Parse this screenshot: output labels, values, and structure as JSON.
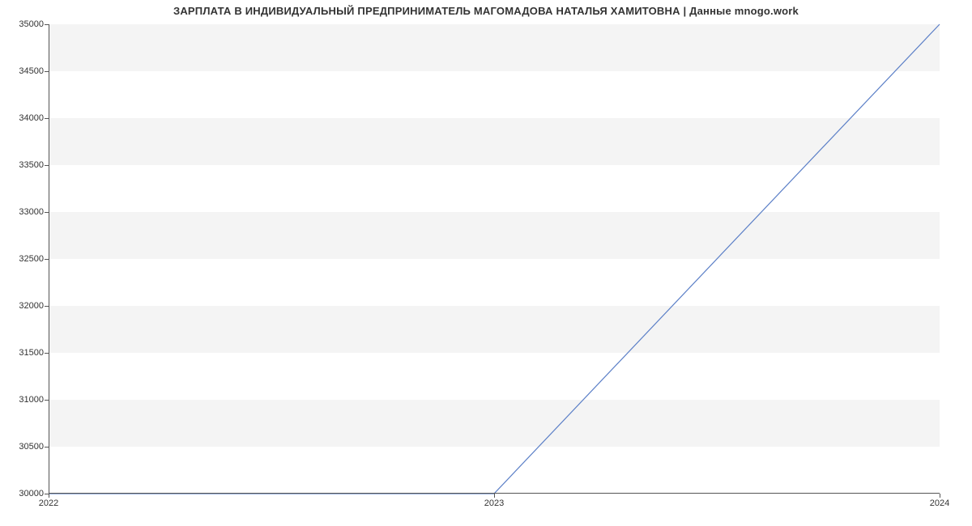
{
  "chart_data": {
    "type": "line",
    "title": "ЗАРПЛАТА В ИНДИВИДУАЛЬНЫЙ ПРЕДПРИНИМАТЕЛЬ МАГОМАДОВА НАТАЛЬЯ ХАМИТОВНА | Данные mnogo.work",
    "xlabel": "",
    "ylabel": "",
    "x": [
      2022,
      2023,
      2024
    ],
    "values": [
      30000,
      30000,
      35000
    ],
    "x_ticks": [
      2022,
      2023,
      2024
    ],
    "y_ticks": [
      30000,
      30500,
      31000,
      31500,
      32000,
      32500,
      33000,
      33500,
      34000,
      34500,
      35000
    ],
    "xlim": [
      2022,
      2024
    ],
    "ylim": [
      30000,
      35000
    ],
    "line_color": "#5b7fc7"
  }
}
